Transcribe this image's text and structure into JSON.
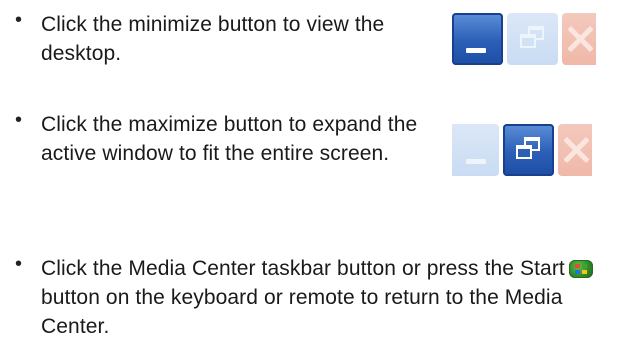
{
  "instructions": [
    {
      "bullet": "•",
      "text": "Click the minimize button to view the desktop."
    },
    {
      "bullet": "•",
      "text": "Click the maximize button to expand the active window to fit the entire screen."
    },
    {
      "bullet": "•",
      "text_before": "Click the Media Center taskbar button or press the Start",
      "text_after": "button on the keyboard or remote to return to the Media Center."
    }
  ],
  "icons": {
    "start": "windows-start-icon",
    "minimize": "minimize-icon",
    "restore": "restore-icon",
    "close": "close-icon"
  },
  "colors": {
    "active_button": "#2b5fb7",
    "inactive_button": "#d2e2f5",
    "close_faded": "#f0b8a8",
    "text": "#1a1a1a"
  }
}
